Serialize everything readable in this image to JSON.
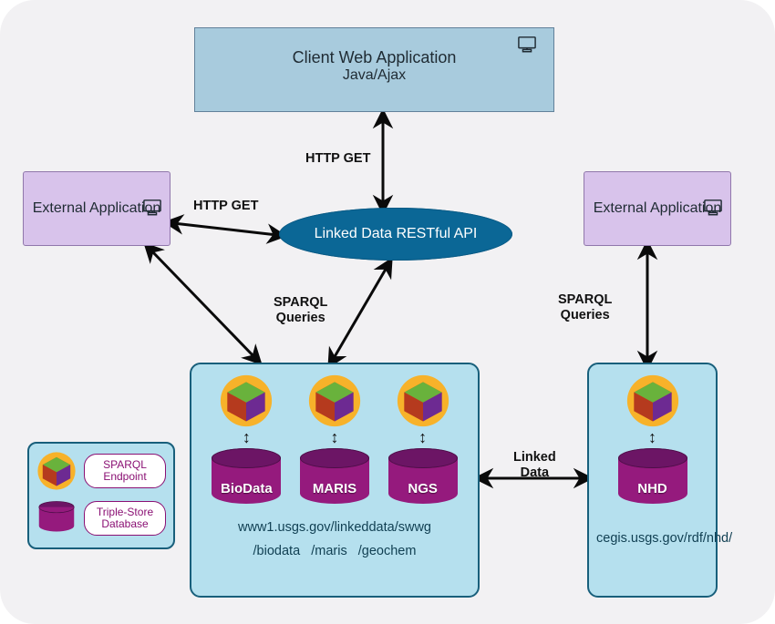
{
  "client": {
    "title": "Client Web Application",
    "subtitle": "Java/Ajax"
  },
  "external_left": {
    "label": "External Application"
  },
  "external_right": {
    "label": "External Application"
  },
  "api": {
    "label": "Linked Data RESTful API"
  },
  "edge_labels": {
    "http_get_top": "HTTP GET",
    "http_get_left": "HTTP GET",
    "sparql_left": "SPARQL\nQueries",
    "sparql_right": "SPARQL\nQueries",
    "linked_data": "Linked\nData"
  },
  "stores_left": {
    "items": [
      {
        "name": "BioData"
      },
      {
        "name": "MARIS"
      },
      {
        "name": "NGS"
      }
    ],
    "url_top": "www1.usgs.gov/linkeddata/swwg",
    "url_bottom": "/biodata   /maris   /geochem"
  },
  "stores_right": {
    "items": [
      {
        "name": "NHD"
      }
    ],
    "url": "cegis.usgs.gov/rdf/nhd/"
  },
  "legend": {
    "sparql": "SPARQL\nEndpoint",
    "triple": "Triple-Store\nDatabase"
  }
}
